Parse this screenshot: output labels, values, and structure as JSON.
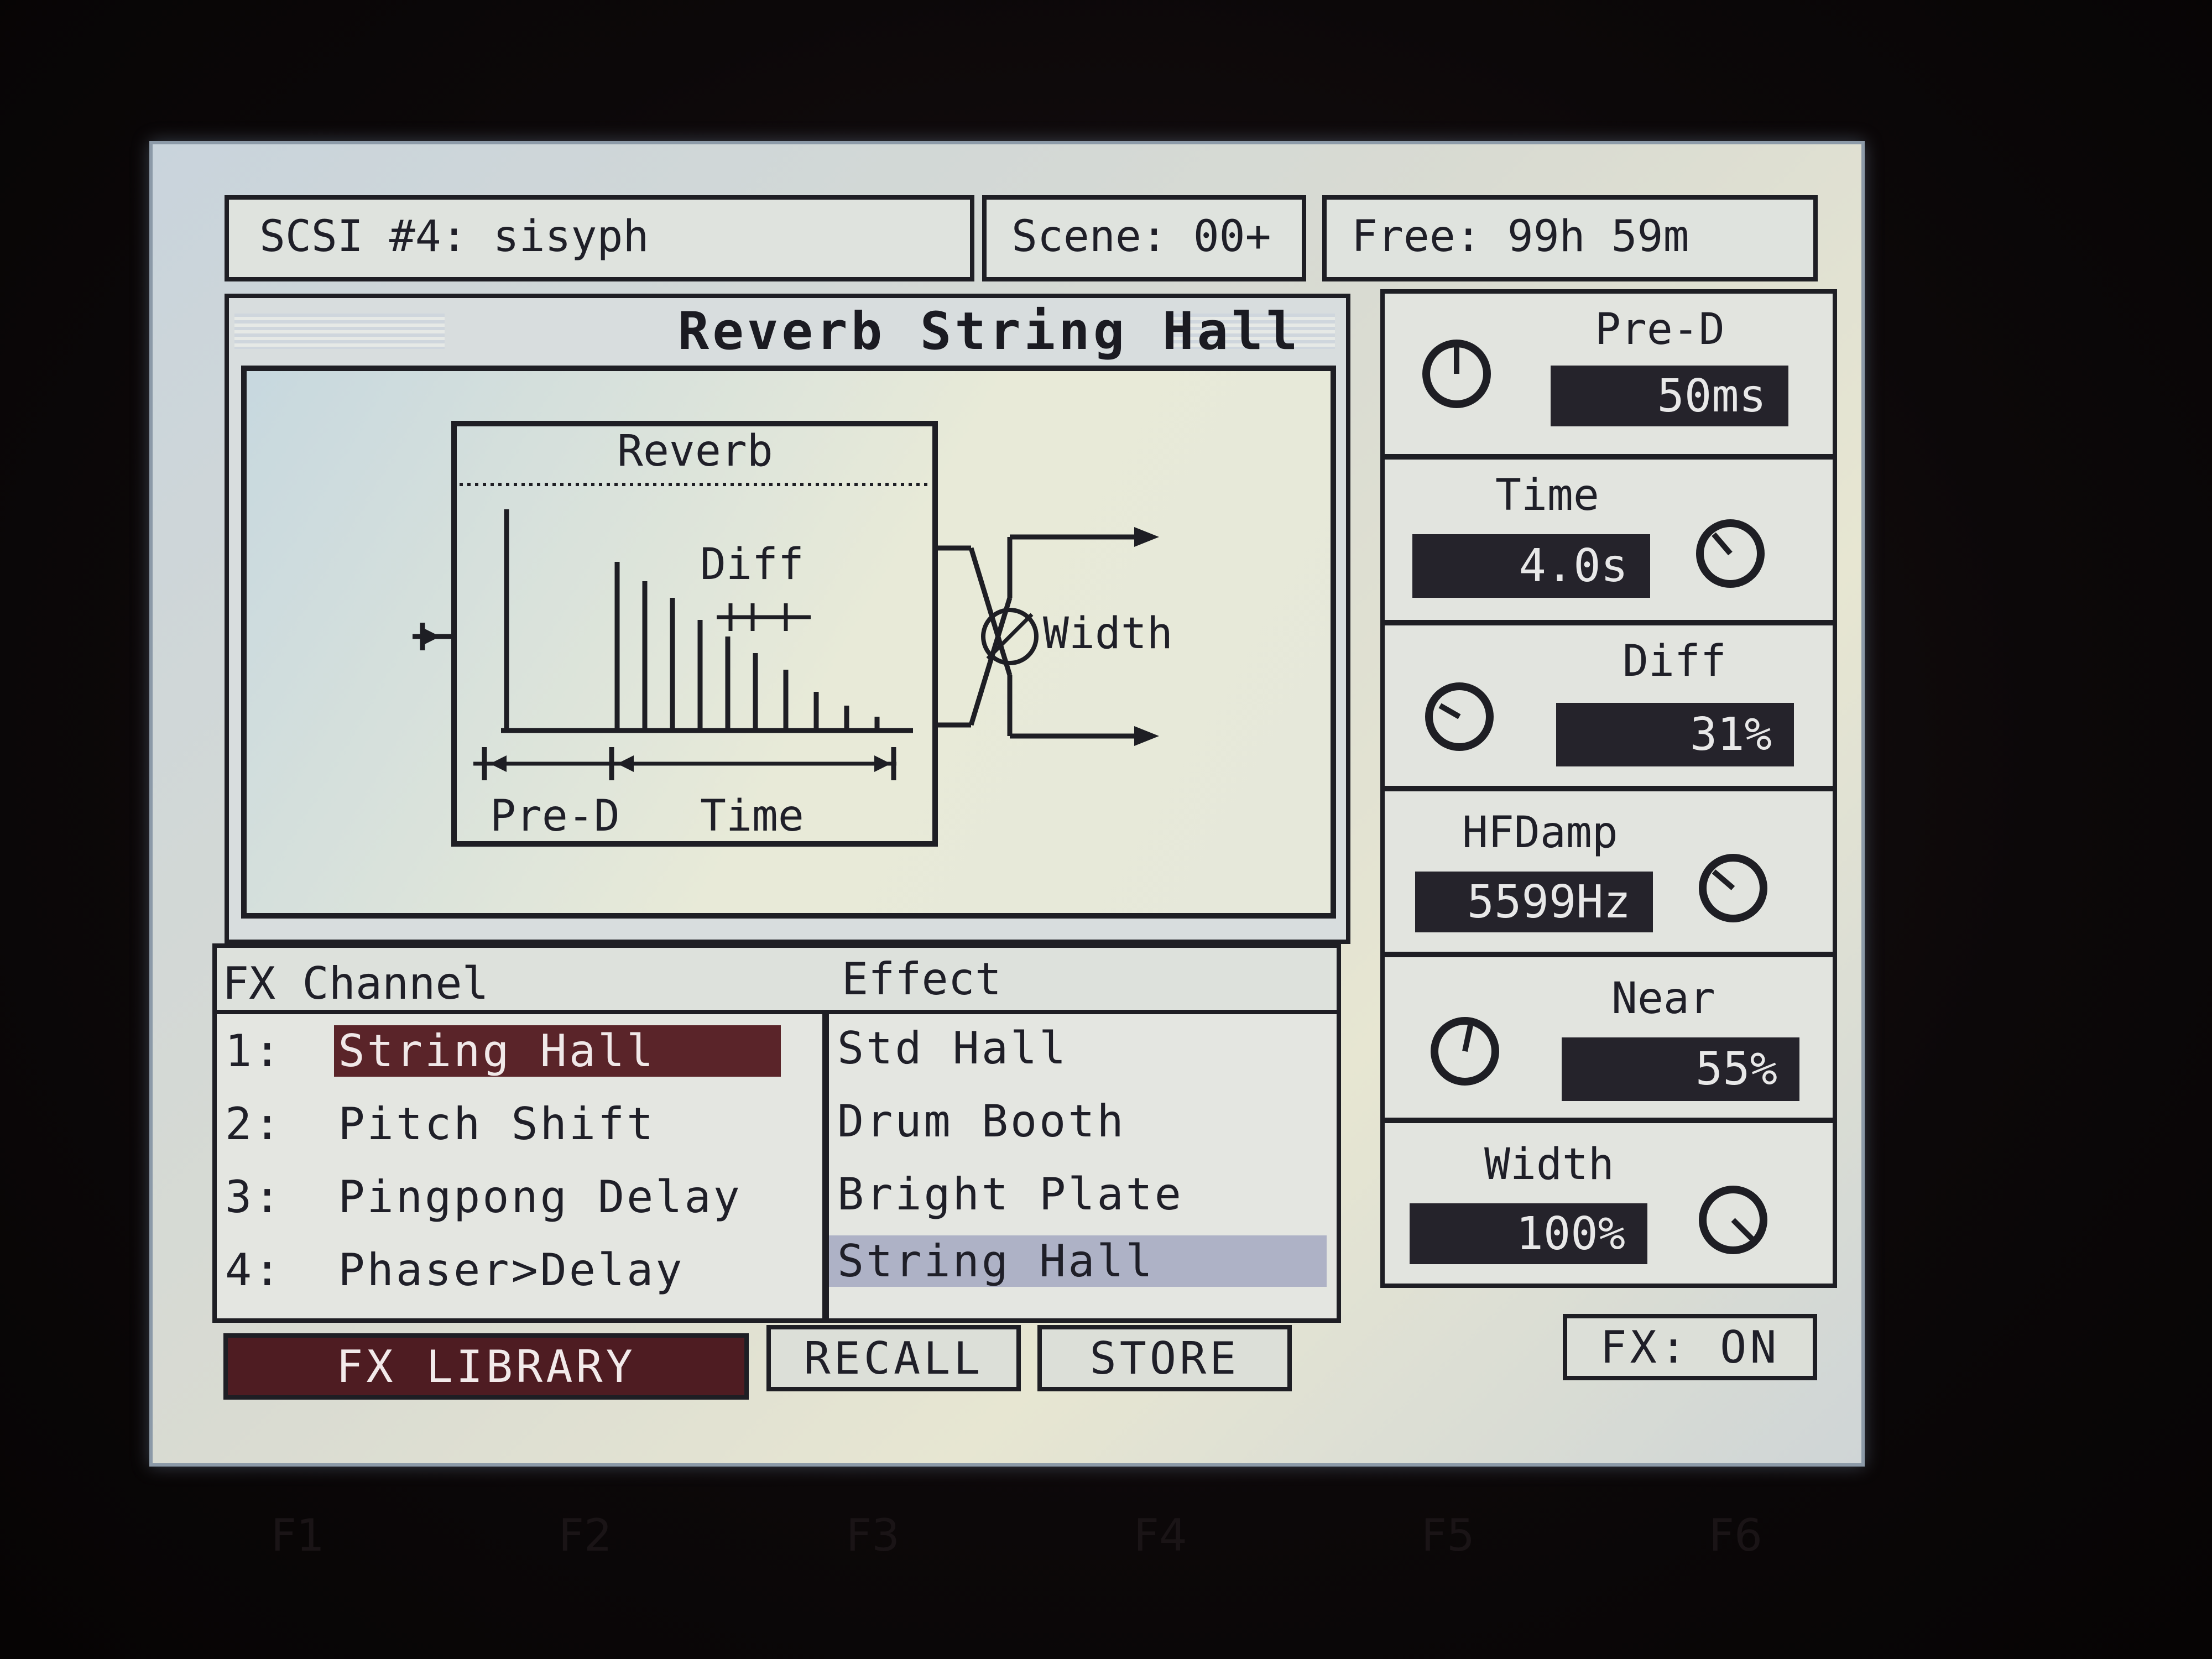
{
  "header": {
    "source": "SCSI #4: sisyph",
    "scene": "Scene: 00+",
    "free": "Free: 99h 59m"
  },
  "effect_title": "Reverb String Hall",
  "diagram": {
    "box_title": "Reverb",
    "diff_label": "Diff",
    "width_label": "Width",
    "pred_label": "Pre-D",
    "time_label": "Time"
  },
  "params": [
    {
      "label": "Pre-D",
      "value": "50ms"
    },
    {
      "label": "Time",
      "value": "4.0s"
    },
    {
      "label": "Diff",
      "value": "31%"
    },
    {
      "label": "HFDamp",
      "value": "5599Hz"
    },
    {
      "label": "Near",
      "value": "55%"
    },
    {
      "label": "Width",
      "value": "100%"
    }
  ],
  "fx_channel": {
    "header": "FX Channel",
    "items": [
      {
        "num": "1:",
        "name": "String Hall",
        "selected": true
      },
      {
        "num": "2:",
        "name": "Pitch Shift"
      },
      {
        "num": "3:",
        "name": "Pingpong Delay"
      },
      {
        "num": "4:",
        "name": "Phaser>Delay"
      }
    ]
  },
  "effect_list": {
    "header": "Effect",
    "items": [
      "Std Hall",
      "Drum Booth",
      "Bright Plate",
      "String Hall"
    ],
    "highlighted_index": 3
  },
  "buttons": {
    "fx_library": "FX LIBRARY",
    "recall": "RECALL",
    "store": "STORE",
    "fx_on": "FX: ON"
  },
  "fkeys": [
    "F1",
    "F2",
    "F3",
    "F4",
    "F5",
    "F6"
  ],
  "colors": {
    "selection": "#5a2429",
    "highlight": "#aeb2c6",
    "value_box": "#25232b"
  }
}
